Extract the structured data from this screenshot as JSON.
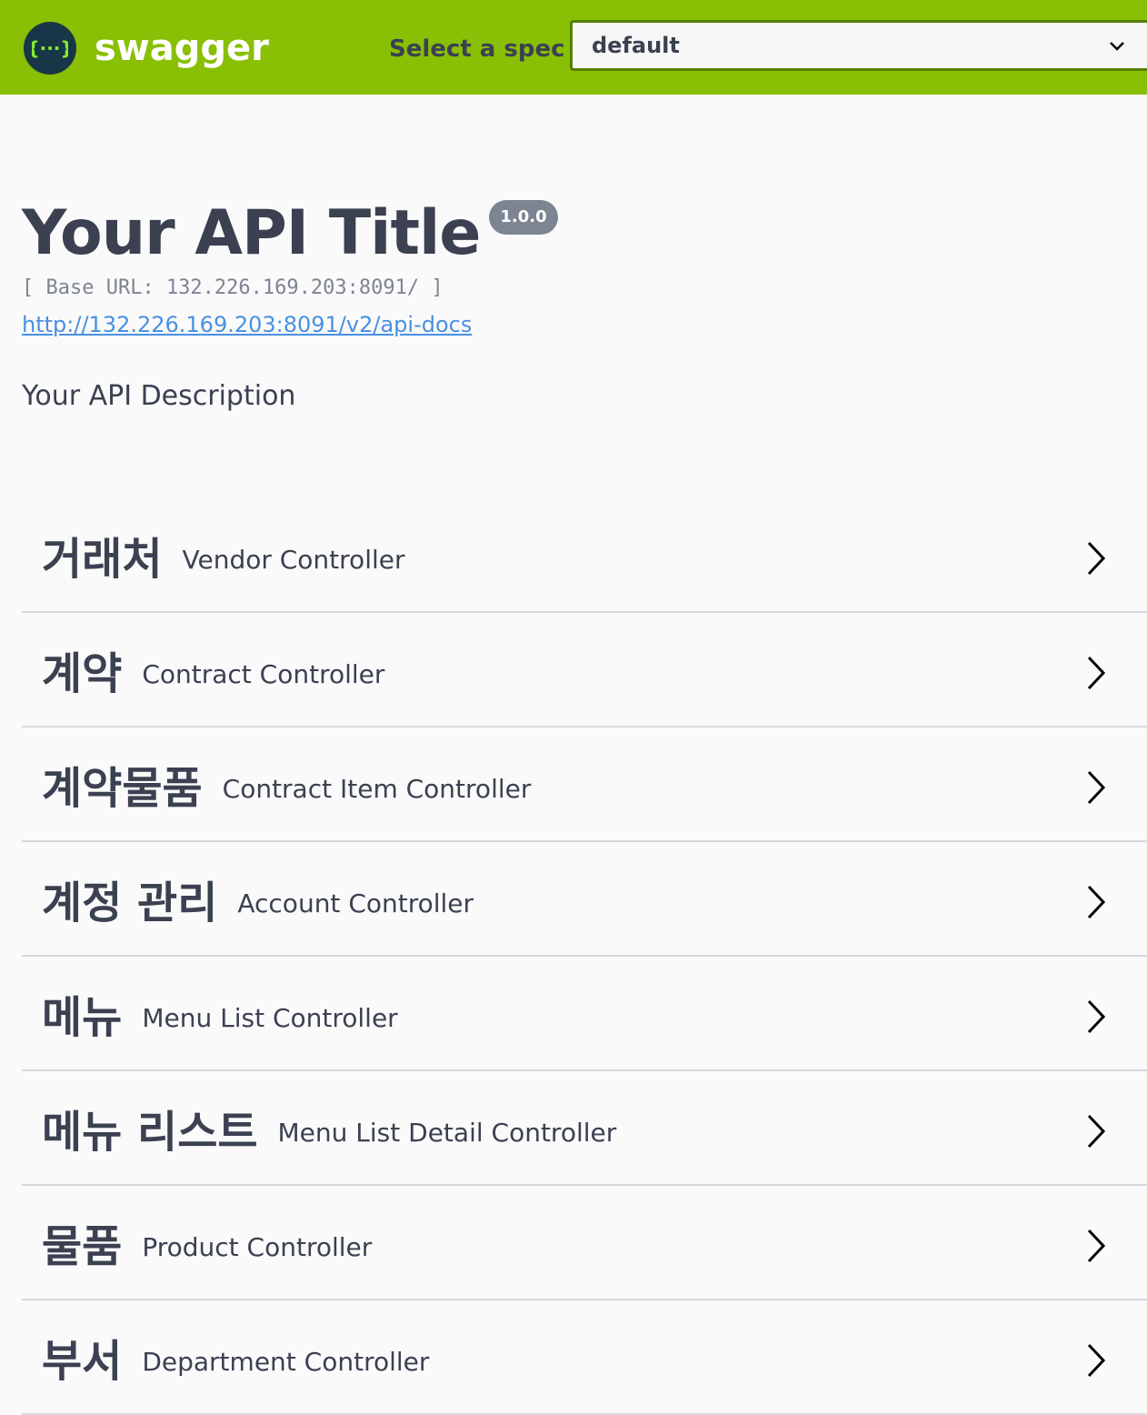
{
  "header": {
    "logo_text": "swagger",
    "spec_label": "Select a spec",
    "spec_selected": "default",
    "background_color": "#89bf04"
  },
  "info": {
    "title": "Your API Title",
    "version": "1.0.0",
    "base_url": "[ Base URL: 132.226.169.203:8091/ ]",
    "docs_link": "http://132.226.169.203:8091/v2/api-docs",
    "description": "Your API Description"
  },
  "tags": [
    {
      "name": "거래처",
      "description": "Vendor Controller"
    },
    {
      "name": "계약",
      "description": "Contract Controller"
    },
    {
      "name": "계약물품",
      "description": "Contract Item Controller"
    },
    {
      "name": "계정 관리",
      "description": "Account Controller"
    },
    {
      "name": "메뉴",
      "description": "Menu List Controller"
    },
    {
      "name": "메뉴 리스트",
      "description": "Menu List Detail Controller"
    },
    {
      "name": "물품",
      "description": "Product Controller"
    },
    {
      "name": "부서",
      "description": "Department Controller"
    }
  ]
}
